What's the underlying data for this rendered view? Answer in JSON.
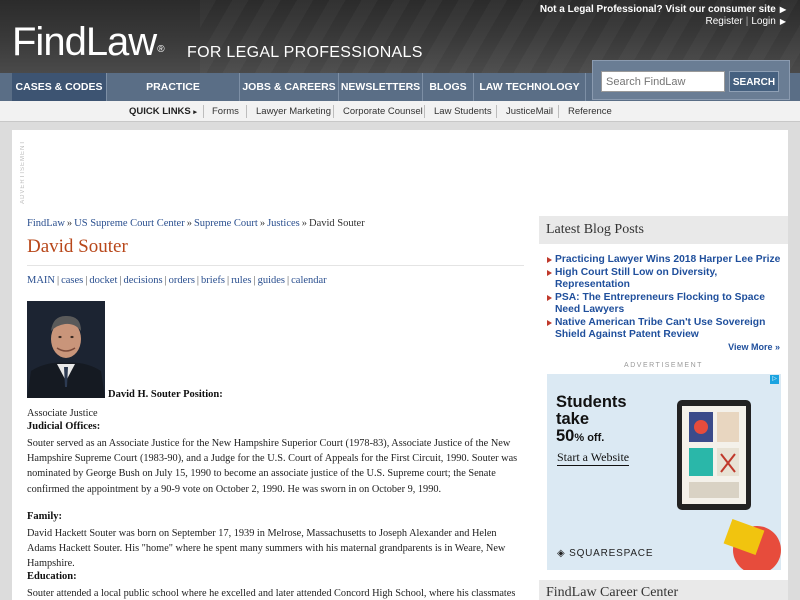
{
  "header": {
    "logo_text": "FindLaw",
    "logo_mark": "®",
    "tagline": "FOR LEGAL PROFESSIONALS",
    "consumer_link": "Not a Legal Professional? Visit our consumer site",
    "register_label": "Register",
    "login_label": "Login"
  },
  "nav": {
    "items": [
      {
        "label": "CASES & CODES"
      },
      {
        "label": "PRACTICE MANAGEMENT"
      },
      {
        "label": "JOBS & CAREERS"
      },
      {
        "label": "NEWSLETTERS"
      },
      {
        "label": "BLOGS"
      },
      {
        "label": "LAW TECHNOLOGY"
      }
    ]
  },
  "search": {
    "placeholder": "Search FindLaw",
    "button_label": "SEARCH"
  },
  "quick_links": {
    "title": "QUICK LINKS",
    "items": [
      "Forms",
      "Lawyer Marketing",
      "Corporate Counsel",
      "Law Students",
      "JusticeMail",
      "Reference"
    ]
  },
  "ad_top": {
    "label": "ADVERTISEMENT"
  },
  "breadcrumb": {
    "items": [
      "FindLaw",
      "US Supreme Court Center",
      "Supreme Court",
      "Justices"
    ],
    "current": "David Souter"
  },
  "page": {
    "title": "David Souter",
    "subnav": [
      "MAIN",
      "cases",
      "docket",
      "decisions",
      "orders",
      "briefs",
      "rules",
      "guides",
      "calendar"
    ]
  },
  "bio": {
    "name_position": "David H. Souter Position:",
    "position": "Associate Justice",
    "judicial_heading": "Judicial Offices:",
    "judicial_text": "Souter served as an Associate Justice for the New Hampshire Superior Court (1978-83), Associate Justice of the New Hampshire Supreme Court (1983-90), and a Judge for the U.S. Court of Appeals for the First Circuit, 1990. Souter was nominated by George Bush on July 15, 1990 to become an associate justice of the U.S. Supreme court; the Senate confirmed the appointment by a 90-9 vote on October 2, 1990. He was sworn in on October 9, 1990.",
    "family_heading": "Family:",
    "family_text": "David Hackett Souter was born on September 17, 1939 in Melrose, Massachusetts to Joseph Alexander and Helen Adams Hackett Souter. His \"home\" where he spent many summers with his maternal grandparents is in Weare, New Hampshire.",
    "education_heading": "Education:",
    "education_text": "Souter attended a local public school where he excelled and later attended Concord High School, where his classmates"
  },
  "sidebar": {
    "blog_heading": "Latest Blog Posts",
    "blog_posts": [
      "Practicing Lawyer Wins 2018 Harper Lee Prize",
      "High Court Still Low on Diversity, Representation",
      "PSA: The Entrepreneurs Flocking to Space Need Lawyers",
      "Native American Tribe Can't Use Sovereign Shield Against Patent Review"
    ],
    "view_more": "View More »",
    "ad_label": "ADVERTISEMENT",
    "ad": {
      "headline_1": "Students",
      "headline_2": "take",
      "headline_pct": "50",
      "headline_pct_suffix": "% off.",
      "cta": "Start a Website",
      "brand": "SQUARESPACE",
      "accent": "#e74c3c"
    },
    "career_heading": "FindLaw Career Center"
  }
}
